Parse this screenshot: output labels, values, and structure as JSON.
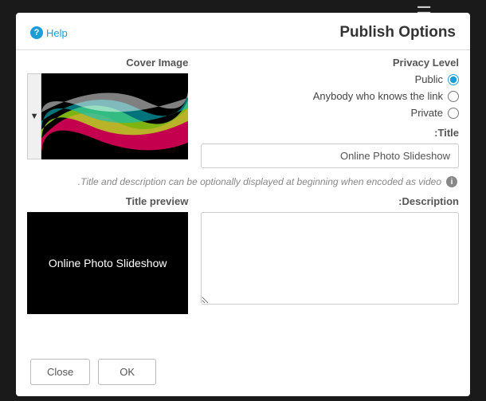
{
  "dialog": {
    "title": "Publish Options",
    "help": "Help"
  },
  "privacy": {
    "label": "Privacy Level",
    "options": {
      "public": "Public",
      "link": "Anybody who knows the link",
      "private": "Private"
    }
  },
  "titleField": {
    "label": "Title:",
    "value": "Online Photo Slideshow"
  },
  "cover": {
    "label": "Cover Image"
  },
  "hint": "Title and description can be optionally displayed at beginning when encoded as video.",
  "description": {
    "label": "Description:"
  },
  "preview": {
    "label": "Title preview",
    "text": "Online Photo Slideshow"
  },
  "buttons": {
    "ok": "OK",
    "close": "Close"
  }
}
